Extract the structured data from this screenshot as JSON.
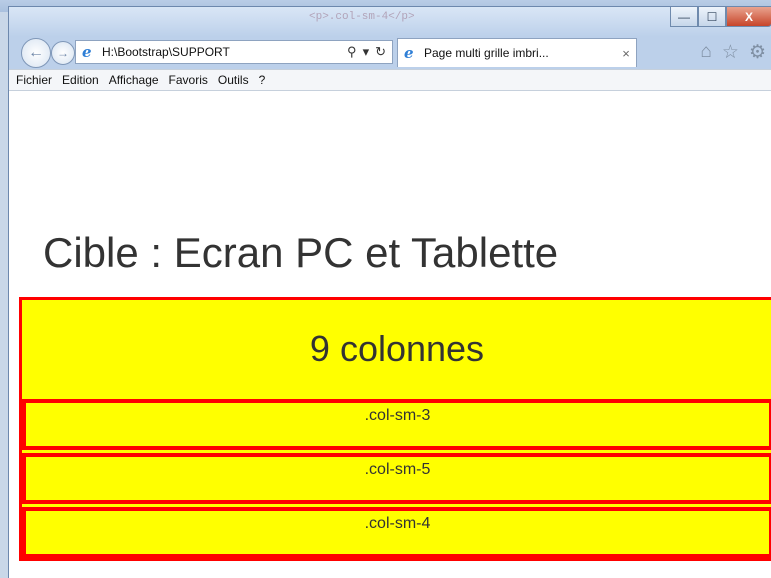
{
  "window": {
    "title": "<p>.col-sm-4</p>",
    "minimize_label": "—",
    "maximize_label": "☐",
    "close_label": "X"
  },
  "nav": {
    "back_icon": "back-arrow-icon",
    "forward_icon": "forward-arrow-icon",
    "address": "H:\\Bootstrap\\SUPPORT",
    "search_glyph": "⚲",
    "dropdown_glyph": "▾",
    "refresh_glyph": "↻",
    "tab_title": "Page multi grille imbri...",
    "tab_close": "×"
  },
  "menu": [
    "Fichier",
    "Edition",
    "Affichage",
    "Favoris",
    "Outils",
    "?"
  ],
  "page": {
    "heading": "Cible : Ecran PC et Tablette",
    "main_column": "9 colonnes",
    "rows": [
      ".col-sm-3",
      ".col-sm-5",
      ".col-sm-4"
    ]
  },
  "colors": {
    "yellow": "#ffff00",
    "red": "#ff0000",
    "text": "#333333"
  }
}
